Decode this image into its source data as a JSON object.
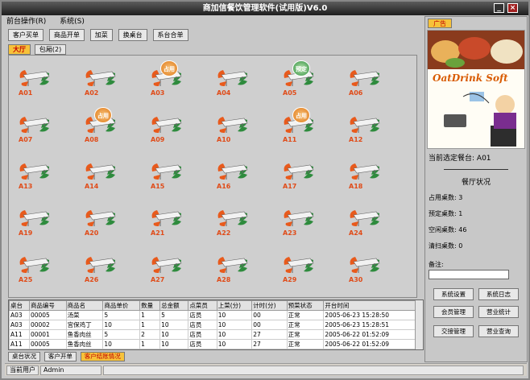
{
  "window": {
    "title": "商加信餐饮管理软件(试用版)V6.0",
    "min": "_",
    "close": "×"
  },
  "menu": [
    "前台操作(R)",
    "系统(S)"
  ],
  "toolbar": [
    "客户买单",
    "商品开单",
    "加菜",
    "换桌台",
    "系台合单"
  ],
  "floor_tabs": [
    "大厅",
    "包厢(2)"
  ],
  "tables": [
    {
      "label": "A01",
      "badge": ""
    },
    {
      "label": "A02",
      "badge": ""
    },
    {
      "label": "A03",
      "badge": "占用"
    },
    {
      "label": "A04",
      "badge": ""
    },
    {
      "label": "A05",
      "badge": "预定"
    },
    {
      "label": "A06",
      "badge": ""
    },
    {
      "label": "A07",
      "badge": ""
    },
    {
      "label": "A08",
      "badge": "占用"
    },
    {
      "label": "A09",
      "badge": ""
    },
    {
      "label": "A10",
      "badge": ""
    },
    {
      "label": "A11",
      "badge": "占用"
    },
    {
      "label": "A12",
      "badge": ""
    },
    {
      "label": "A13",
      "badge": ""
    },
    {
      "label": "A14",
      "badge": ""
    },
    {
      "label": "A15",
      "badge": ""
    },
    {
      "label": "A16",
      "badge": ""
    },
    {
      "label": "A17",
      "badge": ""
    },
    {
      "label": "A18",
      "badge": ""
    },
    {
      "label": "A19",
      "badge": ""
    },
    {
      "label": "A20",
      "badge": ""
    },
    {
      "label": "A21",
      "badge": ""
    },
    {
      "label": "A22",
      "badge": ""
    },
    {
      "label": "A23",
      "badge": ""
    },
    {
      "label": "A24",
      "badge": ""
    },
    {
      "label": "A25",
      "badge": ""
    },
    {
      "label": "A26",
      "badge": ""
    },
    {
      "label": "A27",
      "badge": ""
    },
    {
      "label": "A28",
      "badge": ""
    },
    {
      "label": "A29",
      "badge": ""
    },
    {
      "label": "A30",
      "badge": ""
    }
  ],
  "grid": {
    "headers": [
      "桌台",
      "商品编号",
      "商品名",
      "商品单价",
      "数量",
      "总金额",
      "点菜员",
      "上菜(分)",
      "计时(分)",
      "预菜状态",
      "开台时间"
    ],
    "rows": [
      [
        "A03",
        "00005",
        "汤菜",
        "5",
        "1",
        "5",
        "店员",
        "10",
        "00",
        "正常",
        "2005-06-23 15:28:50"
      ],
      [
        "A03",
        "00002",
        "宫保鸡丁",
        "10",
        "1",
        "10",
        "店员",
        "10",
        "00",
        "正常",
        "2005-06-23 15:28:51"
      ],
      [
        "A11",
        "00001",
        "鱼香肉丝",
        "5",
        "2",
        "10",
        "店员",
        "10",
        "27",
        "正常",
        "2005-06-22 01:52:09"
      ],
      [
        "A11",
        "00005",
        "鱼香肉丝",
        "10",
        "1",
        "10",
        "店员",
        "10",
        "27",
        "正常",
        "2005-06-22 01:52:09"
      ]
    ]
  },
  "bottom_tabs": [
    "桌台状况",
    "客户开单",
    "客户结账情况"
  ],
  "status": {
    "user_label": "当前用户",
    "user": "Admin"
  },
  "right": {
    "tab": "广告",
    "brand": "OatDrink Soft",
    "current_table_label": "当前选定餐台:",
    "current_table": "A01",
    "hall_status_title": "餐厅状况",
    "stats": [
      {
        "label": "占用桌数:",
        "value": "3"
      },
      {
        "label": "预定桌数:",
        "value": "1"
      },
      {
        "label": "空闲桌数:",
        "value": "46"
      },
      {
        "label": "清扫桌数:",
        "value": "0"
      }
    ],
    "remark_label": "备注:",
    "buttons": [
      "系统设置",
      "系统日志",
      "会员管理",
      "营业统计",
      "交接管理",
      "营业查询"
    ]
  },
  "colors": {
    "accent": "#f6c23a",
    "label_red": "#e04b18",
    "occupied": "#e07a1a",
    "reserved": "#2f8f3e"
  }
}
